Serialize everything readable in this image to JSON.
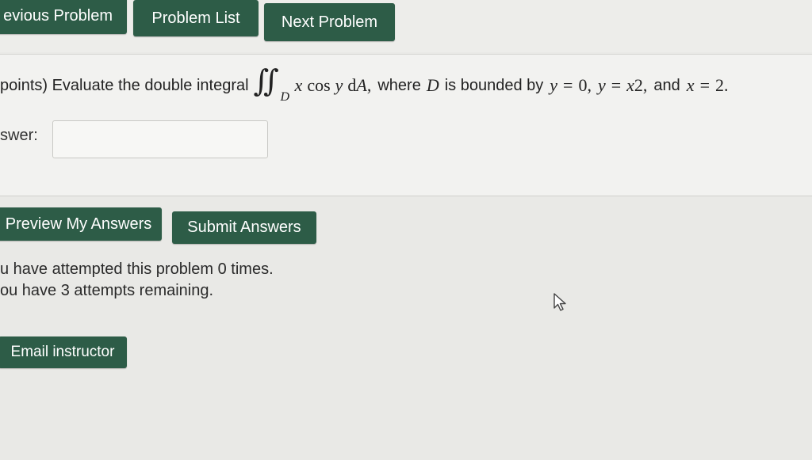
{
  "nav": {
    "previous_label": "evious Problem",
    "list_label": "Problem List",
    "next_label": "Next Problem"
  },
  "problem": {
    "prefix": "points) Evaluate the double integral",
    "integral_symbol": "∬",
    "domain_sub": "D",
    "integrand_x": "x",
    "integrand_cos": "cos",
    "integrand_y": "y",
    "integrand_d": "d",
    "integrand_A": "A",
    "comma": ",",
    "where_text": "where",
    "region_D": "D",
    "bounded_text": "is bounded by",
    "y1": "y",
    "eq1": "=",
    "zero": "0,",
    "y2": "y",
    "eq2": "=",
    "x2": "x",
    "exp2": "2",
    "comma2": ",",
    "and_text": "and",
    "x3": "x",
    "eq3": "=",
    "two": "2."
  },
  "answer": {
    "label": "swer:",
    "value": "",
    "placeholder": ""
  },
  "actions": {
    "preview_label": "Preview My Answers",
    "submit_label": "Submit Answers"
  },
  "status": {
    "attempted": "u have attempted this problem 0 times.",
    "remaining": "ou have 3 attempts remaining."
  },
  "footer": {
    "email_label": "Email instructor"
  },
  "colors": {
    "button_bg": "#2d5c47",
    "page_bg": "#e9e9e6"
  }
}
